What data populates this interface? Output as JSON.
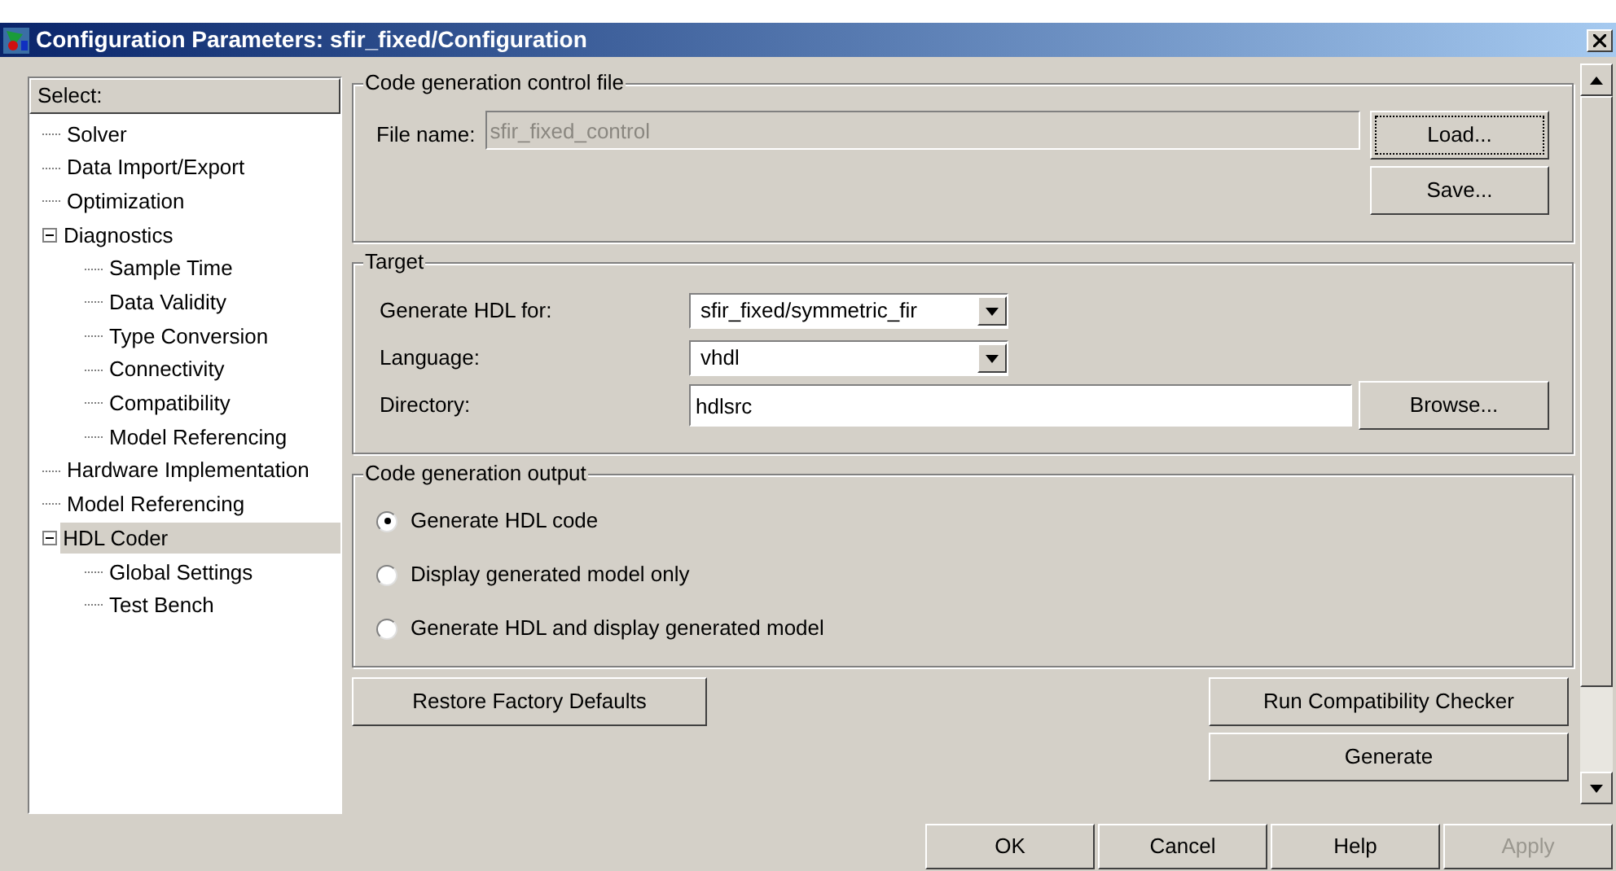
{
  "window": {
    "title": "Configuration Parameters: sfir_fixed/Configuration"
  },
  "tree": {
    "header": "Select:",
    "items": [
      {
        "label": "Solver",
        "selected": false
      },
      {
        "label": "Data Import/Export",
        "selected": false
      },
      {
        "label": "Optimization",
        "selected": false
      },
      {
        "label": "Diagnostics",
        "selected": false,
        "expanded": true,
        "children": [
          {
            "label": "Sample Time",
            "selected": false
          },
          {
            "label": "Data Validity",
            "selected": false
          },
          {
            "label": "Type Conversion",
            "selected": false
          },
          {
            "label": "Connectivity",
            "selected": false
          },
          {
            "label": "Compatibility",
            "selected": false
          },
          {
            "label": "Model Referencing",
            "selected": false
          }
        ]
      },
      {
        "label": "Hardware Implementation",
        "selected": false
      },
      {
        "label": "Model Referencing",
        "selected": false
      },
      {
        "label": "HDL Coder",
        "selected": true,
        "expanded": true,
        "children": [
          {
            "label": "Global Settings",
            "selected": false
          },
          {
            "label": "Test Bench",
            "selected": false
          }
        ]
      }
    ]
  },
  "control_file": {
    "legend": "Code generation control file",
    "label": "File name:",
    "value": "sfir_fixed_control",
    "disabled": true,
    "buttons": [
      {
        "label": "Load...",
        "focused": true
      },
      {
        "label": "Save...",
        "focused": false
      }
    ]
  },
  "target": {
    "legend": "Target",
    "fields": [
      {
        "kind": "dropdown",
        "label": "Generate HDL for:",
        "value": "sfir_fixed/symmetric_fir"
      },
      {
        "kind": "dropdown",
        "label": "Language:",
        "value": "vhdl"
      },
      {
        "kind": "text",
        "label": "Directory:",
        "value": "hdlsrc",
        "button": "Browse..."
      }
    ]
  },
  "output": {
    "legend": "Code generation output",
    "options": [
      {
        "label": "Generate HDL code",
        "selected": true
      },
      {
        "label": "Display generated model only",
        "selected": false
      },
      {
        "label": "Generate HDL and display generated model",
        "selected": false
      }
    ]
  },
  "restore_button": "Restore Factory Defaults",
  "action_buttons": [
    "Run Compatibility Checker",
    "Generate"
  ],
  "dialog_buttons": [
    {
      "label": "OK",
      "disabled": false
    },
    {
      "label": "Cancel",
      "disabled": false
    },
    {
      "label": "Help",
      "disabled": false
    },
    {
      "label": "Apply",
      "disabled": true
    }
  ]
}
